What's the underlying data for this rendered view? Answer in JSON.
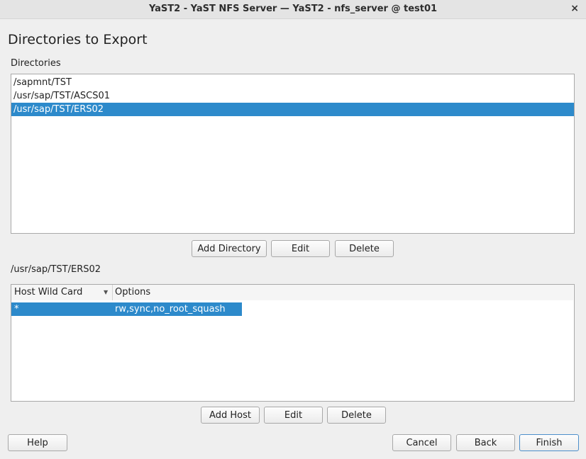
{
  "window": {
    "title": "YaST2 - YaST NFS Server — YaST2 - nfs_server @ test01",
    "close_glyph": "×"
  },
  "page": {
    "heading": "Directories to Export",
    "directories_label": "Directories"
  },
  "directories": {
    "items": [
      "/sapmnt/TST",
      "/usr/sap/TST/ASCS01",
      "/usr/sap/TST/ERS02"
    ],
    "selected_index": 2
  },
  "dir_buttons": {
    "add": "Add Directory",
    "edit": "Edit",
    "delete": "Delete"
  },
  "hosts": {
    "section_label": "/usr/sap/TST/ERS02",
    "columns": [
      "Host Wild Card",
      "Options"
    ],
    "rows": [
      {
        "host": "*",
        "options": "rw,sync,no_root_squash"
      }
    ],
    "selected_index": 0
  },
  "host_buttons": {
    "add": "Add Host",
    "edit": "Edit",
    "delete": "Delete"
  },
  "footer": {
    "help": "Help",
    "cancel": "Cancel",
    "back": "Back",
    "finish": "Finish"
  },
  "colors": {
    "selection": "#2d8acb",
    "background": "#efefef"
  }
}
